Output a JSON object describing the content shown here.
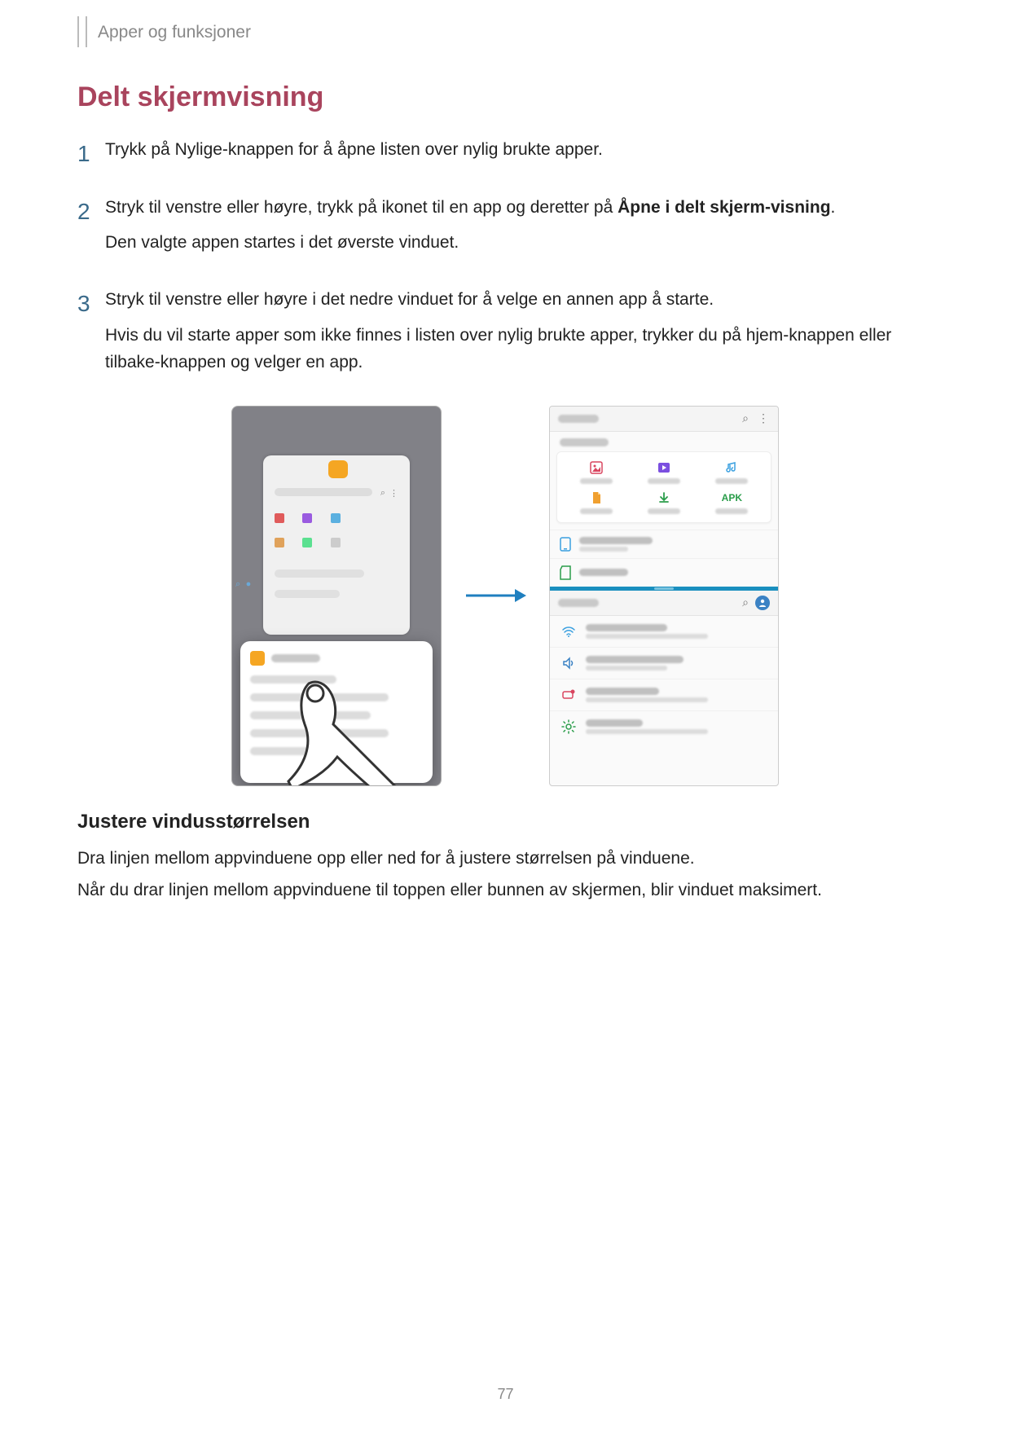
{
  "breadcrumb": "Apper og funksjoner",
  "h1": "Delt skjermvisning",
  "steps": [
    {
      "num": "1",
      "paragraphs": [
        "Trykk på Nylige-knappen for å åpne listen over nylig brukte apper."
      ]
    },
    {
      "num": "2",
      "paragraphs": [
        "Stryk til venstre eller høyre, trykk på ikonet til en app og deretter på ",
        "Den valgte appen startes i det øverste vinduet."
      ],
      "bold_inline": "Åpne i delt skjerm-visning",
      "trailing": "."
    },
    {
      "num": "3",
      "paragraphs": [
        "Stryk til venstre eller høyre i det nedre vinduet for å velge en annen app å starte.",
        "Hvis du vil starte apper som ikke finnes i listen over nylig brukte apper, trykker du på hjem-knappen eller tilbake-knappen og velger en app."
      ]
    }
  ],
  "right_phone": {
    "apk_label": "APK"
  },
  "h2": "Justere vindusstørrelsen",
  "p1": "Dra linjen mellom appvinduene opp eller ned for å justere størrelsen på vinduene.",
  "p2": "Når du drar linjen mellom appvinduene til toppen eller bunnen av skjermen, blir vinduet maksimert.",
  "page_number": "77"
}
